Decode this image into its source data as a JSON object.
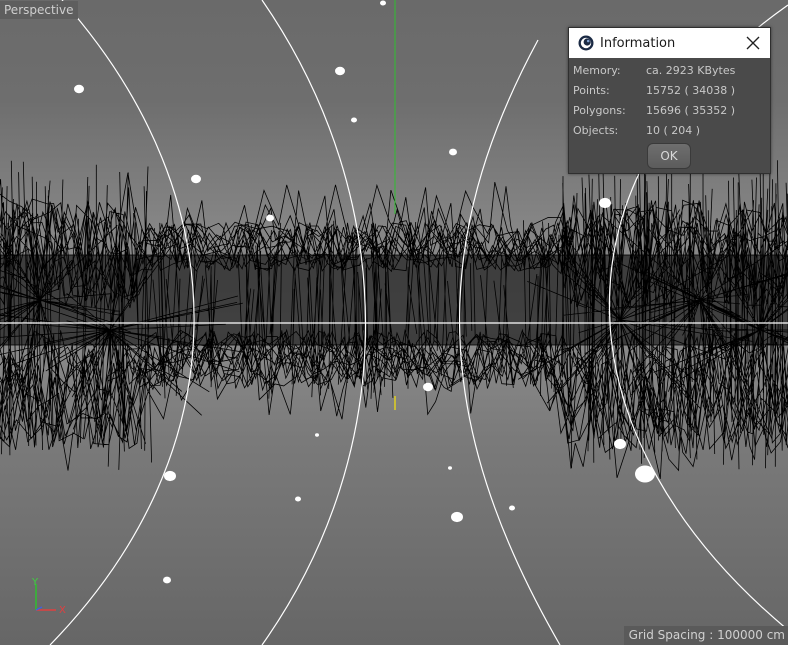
{
  "viewport": {
    "view_name": "Perspective",
    "grid_spacing": "Grid Spacing : 100000 cm",
    "axes": {
      "y": "Y",
      "x": "X"
    }
  },
  "info_dialog": {
    "title": "Information",
    "app_icon": "cinema4d-logo-icon",
    "close_icon": "close-icon",
    "rows": [
      {
        "label": "Memory:",
        "value": "ca. 2923 KBytes"
      },
      {
        "label": "Points:",
        "value": "15752 ( 34038 )"
      },
      {
        "label": "Polygons:",
        "value": "15696 ( 35352 )"
      },
      {
        "label": "Objects:",
        "value": "10 ( 204 )"
      }
    ],
    "ok_label": "OK"
  },
  "colors": {
    "viewport_background": "#7e7e7e",
    "wireframe": "#000000",
    "particles": "#ffffff",
    "y_axis": "#2fbf2f",
    "x_axis": "#e04040",
    "pivot": "#e0d020"
  }
}
